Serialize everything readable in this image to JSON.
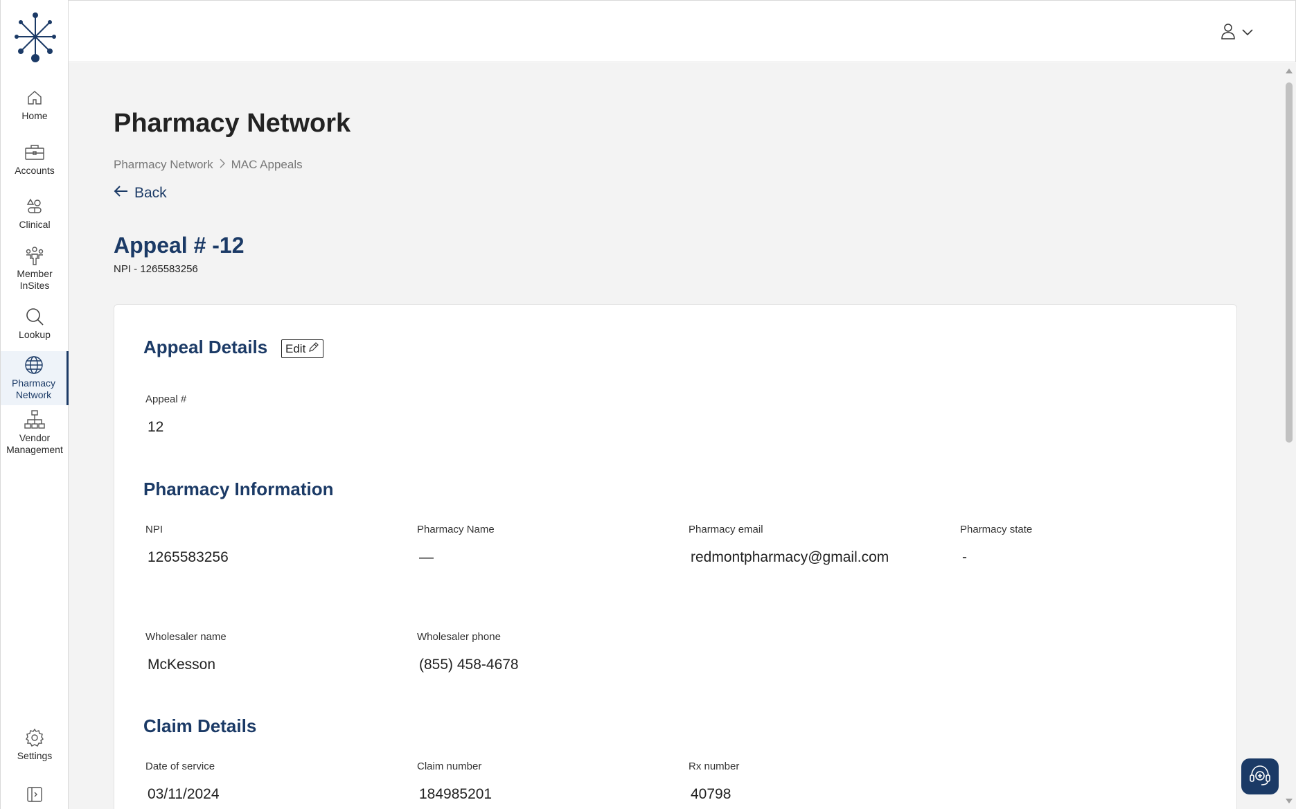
{
  "sidebar": {
    "items": [
      {
        "label": "Home",
        "icon": "home-icon"
      },
      {
        "label": "Accounts",
        "icon": "briefcase-icon"
      },
      {
        "label": "Clinical",
        "icon": "clinical-icon"
      },
      {
        "label": "Member InSites",
        "icon": "people-icon"
      },
      {
        "label": "Lookup",
        "icon": "search-icon"
      },
      {
        "label": "Pharmacy Network",
        "icon": "globe-icon",
        "active": true
      },
      {
        "label": "Vendor Management",
        "icon": "org-chart-icon"
      }
    ],
    "settings_label": "Settings"
  },
  "page": {
    "title": "Pharmacy Network",
    "breadcrumb": [
      "Pharmacy Network",
      "MAC Appeals"
    ],
    "back_label": "Back",
    "appeal_title": "Appeal # -12",
    "appeal_npi": "NPI - 1265583256"
  },
  "appeal_details": {
    "title": "Appeal Details",
    "edit_label": "Edit",
    "appeal_number_label": "Appeal #",
    "appeal_number_value": "12"
  },
  "pharmacy_info": {
    "title": "Pharmacy Information",
    "npi_label": "NPI",
    "npi_value": "1265583256",
    "name_label": "Pharmacy Name",
    "name_value": "—",
    "email_label": "Pharmacy email",
    "email_value": "redmontpharmacy@gmail.com",
    "state_label": "Pharmacy state",
    "state_value": "-",
    "wholesaler_name_label": "Wholesaler name",
    "wholesaler_name_value": "McKesson",
    "wholesaler_phone_label": "Wholesaler phone",
    "wholesaler_phone_value": "(855) 458-4678"
  },
  "claim_details": {
    "title": "Claim Details",
    "date_label": "Date of service",
    "date_value": "03/11/2024",
    "claim_label": "Claim number",
    "claim_value": "184985201",
    "rx_label": "Rx number",
    "rx_value": "40798"
  },
  "colors": {
    "accent": "#1b3a66",
    "background": "#f3f3f3"
  }
}
